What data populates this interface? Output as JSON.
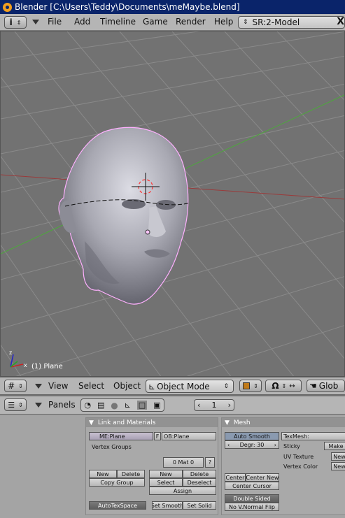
{
  "window": {
    "title": "Blender [C:\\Users\\Teddy\\Documents\\meMaybe.blend]"
  },
  "menubar": {
    "items": [
      "File",
      "Add",
      "Timeline",
      "Game",
      "Render",
      "Help"
    ],
    "scene": "SR:2-Model",
    "close": "X"
  },
  "viewport": {
    "object_label": "(1) Plane"
  },
  "view_header": {
    "menus": [
      "View",
      "Select",
      "Object"
    ],
    "mode": "Object Mode",
    "orientation": "Glob"
  },
  "buttons_header": {
    "panels_label": "Panels",
    "frame": "1"
  },
  "link_materials": {
    "title": "Link and Materials",
    "mesh_name": "ME:Plane",
    "f_flag": "F",
    "object_name": "OB:Plane",
    "vertex_groups": "Vertex Groups",
    "mat_counter": "0 Mat 0",
    "mat_help": "?",
    "new": "New",
    "delete": "Delete",
    "copy_group": "Copy Group",
    "mat_new": "New",
    "mat_delete": "Delete",
    "select": "Select",
    "deselect": "Deselect",
    "assign": "Assign",
    "autotexspace": "AutoTexSpace",
    "set_smooth": "Set Smooth",
    "set_solid": "Set Solid"
  },
  "mesh": {
    "title": "Mesh",
    "auto_smooth": "Auto Smooth",
    "degr": "Degr: 30",
    "texmesh": "TexMesh:",
    "sticky": "Sticky",
    "sticky_btn": "Make",
    "uv_texture": "UV Texture",
    "uv_btn": "New",
    "vertex_color": "Vertex Color",
    "vcol_btn": "New",
    "center": "Center",
    "center_new": "Center New",
    "center_cursor": "Center Cursor",
    "double_sided": "Double Sided",
    "no_vnormal_flip": "No V.Normal Flip"
  }
}
